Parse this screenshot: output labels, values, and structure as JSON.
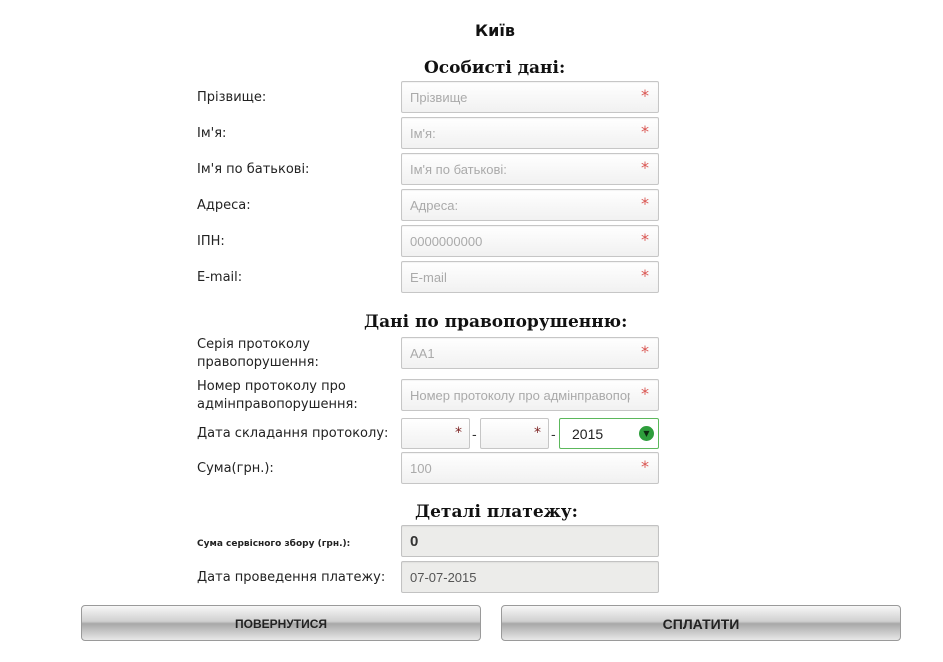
{
  "city": "Київ",
  "sections": {
    "personal": "Особисті дані:",
    "offense": "Дані по правопорушенню:",
    "payment": "Деталі платежу:"
  },
  "personal": {
    "surname": {
      "label": "Прізвище:",
      "placeholder": "Прізвище"
    },
    "name": {
      "label": "Ім'я:",
      "placeholder": "Ім'я:"
    },
    "patronymic": {
      "label": "Ім'я по батькові:",
      "placeholder": "Ім'я по батькові:"
    },
    "address": {
      "label": "Адреса:",
      "placeholder": "Адреса:"
    },
    "ipn": {
      "label": "ІПН:",
      "placeholder": "0000000000"
    },
    "email": {
      "label": "E-mail:",
      "placeholder": "E-mail"
    }
  },
  "offense": {
    "series": {
      "label_line1": "Серія протоколу",
      "label_line2": "правопорушення:",
      "placeholder": "AA1"
    },
    "number": {
      "label_line1": "Номер протоколу про",
      "label_line2": "адмінправопорушення:",
      "placeholder": "Номер протоколу про адмінправопорушення"
    },
    "date": {
      "label": "Дата складання протоколу:",
      "separator": "-",
      "year": "2015"
    },
    "sum": {
      "label": "Сума(грн.):",
      "placeholder": "100"
    }
  },
  "payment": {
    "service_fee": {
      "label": "Сума сервісного збору (грн.):",
      "value": "0"
    },
    "payment_date": {
      "label": "Дата проведення платежу:",
      "value": "07-07-2015"
    }
  },
  "required_mark": "*",
  "buttons": {
    "back": "ПОВЕРНУТИСЯ",
    "pay": "СПЛАТИТИ"
  }
}
